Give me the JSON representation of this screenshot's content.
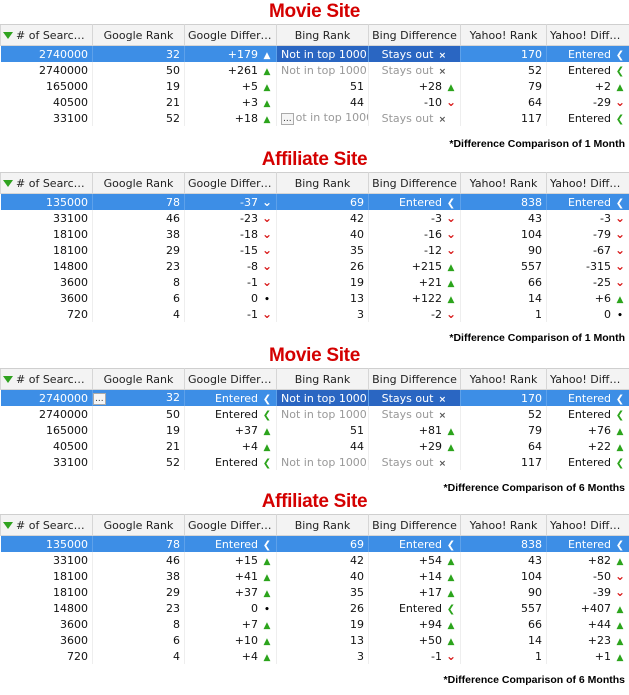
{
  "headers_a": [
    "# of Searches",
    "Google Rank",
    "Google Difference",
    "Bing Rank",
    "Bing Difference",
    "Yahoo! Rank",
    "Yahoo! Difference"
  ],
  "headers_b": [
    "# of Searches",
    "Google Rank",
    "Google Differen...",
    "Bing Rank",
    "Bing Difference",
    "Yahoo! Rank",
    "Yahoo! Differ..."
  ],
  "icon_legend": {
    "up": "up-arrow-icon",
    "down": "down-arrow-icon",
    "left": "left-arrow-icon",
    "dot": "dot-icon",
    "x": "x-icon"
  },
  "sections": [
    {
      "title": "Movie Site",
      "footnote": "*Difference Comparison of 1 Month",
      "header_set": "a",
      "rows": [
        {
          "sel": true,
          "cells": [
            "2740000",
            "32",
            "+179",
            "Not in top 1000",
            "Stays out",
            "170",
            "Entered"
          ],
          "icons": [
            "",
            "",
            "up",
            "",
            "x",
            "",
            "left"
          ]
        },
        {
          "cells": [
            "2740000",
            "50",
            "+261",
            "Not in top 1000",
            "Stays out",
            "52",
            "Entered"
          ],
          "icons": [
            "",
            "",
            "up",
            "",
            "x",
            "",
            "left"
          ]
        },
        {
          "cells": [
            "165000",
            "19",
            "+5",
            "51",
            "+28",
            "79",
            "+2"
          ],
          "icons": [
            "",
            "",
            "up",
            "",
            "up",
            "",
            "up"
          ]
        },
        {
          "cells": [
            "40500",
            "21",
            "+3",
            "44",
            "-10",
            "64",
            "-29"
          ],
          "icons": [
            "",
            "",
            "up",
            "",
            "down",
            "",
            "down"
          ]
        },
        {
          "cells": [
            "33100",
            "52",
            "+18",
            "ot in top 1000",
            "Stays out",
            "117",
            "Entered"
          ],
          "icons": [
            "",
            "",
            "up",
            "",
            "x",
            "",
            "left"
          ],
          "ellip": true
        }
      ]
    },
    {
      "title": "Affiliate Site",
      "footnote": "*Difference Comparison of 1 Month",
      "header_set": "b",
      "rows": [
        {
          "sel": true,
          "cells": [
            "135000",
            "78",
            "-37",
            "69",
            "Entered",
            "838",
            "Entered"
          ],
          "icons": [
            "",
            "",
            "down",
            "",
            "left",
            "",
            "left"
          ]
        },
        {
          "cells": [
            "33100",
            "46",
            "-23",
            "42",
            "-3",
            "43",
            "-3"
          ],
          "icons": [
            "",
            "",
            "down",
            "",
            "down",
            "",
            "down"
          ]
        },
        {
          "cells": [
            "18100",
            "38",
            "-18",
            "40",
            "-16",
            "104",
            "-79"
          ],
          "icons": [
            "",
            "",
            "down",
            "",
            "down",
            "",
            "down"
          ]
        },
        {
          "cells": [
            "18100",
            "29",
            "-15",
            "35",
            "-12",
            "90",
            "-67"
          ],
          "icons": [
            "",
            "",
            "down",
            "",
            "down",
            "",
            "down"
          ]
        },
        {
          "cells": [
            "14800",
            "23",
            "-8",
            "26",
            "+215",
            "557",
            "-315"
          ],
          "icons": [
            "",
            "",
            "down",
            "",
            "up",
            "",
            "down"
          ]
        },
        {
          "cells": [
            "3600",
            "8",
            "-1",
            "19",
            "+21",
            "66",
            "-25"
          ],
          "icons": [
            "",
            "",
            "down",
            "",
            "up",
            "",
            "down"
          ]
        },
        {
          "cells": [
            "3600",
            "6",
            "0",
            "13",
            "+122",
            "14",
            "+6"
          ],
          "icons": [
            "",
            "",
            "dot",
            "",
            "up",
            "",
            "up"
          ]
        },
        {
          "cells": [
            "720",
            "4",
            "-1",
            "3",
            "-2",
            "1",
            "0"
          ],
          "icons": [
            "",
            "",
            "down",
            "",
            "down",
            "",
            "dot"
          ]
        }
      ]
    },
    {
      "title": "Movie Site",
      "footnote": "*Difference Comparison of 6 Months",
      "header_set": "b",
      "rows": [
        {
          "sel": true,
          "cells": [
            "2740000",
            "32",
            "Entered",
            "Not in top 1000",
            "Stays out",
            "170",
            "Entered"
          ],
          "icons": [
            "",
            "",
            "left",
            "",
            "x",
            "",
            "left"
          ],
          "ellip_after_first": true
        },
        {
          "cells": [
            "2740000",
            "50",
            "Entered",
            "Not in top 1000",
            "Stays out",
            "52",
            "Entered"
          ],
          "icons": [
            "",
            "",
            "left",
            "",
            "x",
            "",
            "left"
          ]
        },
        {
          "cells": [
            "165000",
            "19",
            "+37",
            "51",
            "+81",
            "79",
            "+76"
          ],
          "icons": [
            "",
            "",
            "up",
            "",
            "up",
            "",
            "up"
          ]
        },
        {
          "cells": [
            "40500",
            "21",
            "+4",
            "44",
            "+29",
            "64",
            "+22"
          ],
          "icons": [
            "",
            "",
            "up",
            "",
            "up",
            "",
            "up"
          ]
        },
        {
          "cells": [
            "33100",
            "52",
            "Entered",
            "Not in top 1000",
            "Stays out",
            "117",
            "Entered"
          ],
          "icons": [
            "",
            "",
            "left",
            "",
            "x",
            "",
            "left"
          ]
        }
      ]
    },
    {
      "title": "Affiliate Site",
      "footnote": "*Difference Comparison of 6 Months",
      "header_set": "b",
      "rows": [
        {
          "sel": true,
          "cells": [
            "135000",
            "78",
            "Entered",
            "69",
            "Entered",
            "838",
            "Entered"
          ],
          "icons": [
            "",
            "",
            "left",
            "",
            "left",
            "",
            "left"
          ]
        },
        {
          "cells": [
            "33100",
            "46",
            "+15",
            "42",
            "+54",
            "43",
            "+82"
          ],
          "icons": [
            "",
            "",
            "up",
            "",
            "up",
            "",
            "up"
          ]
        },
        {
          "cells": [
            "18100",
            "38",
            "+41",
            "40",
            "+14",
            "104",
            "-50"
          ],
          "icons": [
            "",
            "",
            "up",
            "",
            "up",
            "",
            "down"
          ]
        },
        {
          "cells": [
            "18100",
            "29",
            "+37",
            "35",
            "+17",
            "90",
            "-39"
          ],
          "icons": [
            "",
            "",
            "up",
            "",
            "up",
            "",
            "down"
          ]
        },
        {
          "cells": [
            "14800",
            "23",
            "0",
            "26",
            "Entered",
            "557",
            "+407"
          ],
          "icons": [
            "",
            "",
            "dot",
            "",
            "left",
            "",
            "up"
          ]
        },
        {
          "cells": [
            "3600",
            "8",
            "+7",
            "19",
            "+94",
            "66",
            "+44"
          ],
          "icons": [
            "",
            "",
            "up",
            "",
            "up",
            "",
            "up"
          ]
        },
        {
          "cells": [
            "3600",
            "6",
            "+10",
            "13",
            "+50",
            "14",
            "+23"
          ],
          "icons": [
            "",
            "",
            "up",
            "",
            "up",
            "",
            "up"
          ]
        },
        {
          "cells": [
            "720",
            "4",
            "+4",
            "3",
            "-1",
            "1",
            "+1"
          ],
          "icons": [
            "",
            "",
            "up",
            "",
            "down",
            "",
            "up"
          ]
        }
      ]
    }
  ]
}
